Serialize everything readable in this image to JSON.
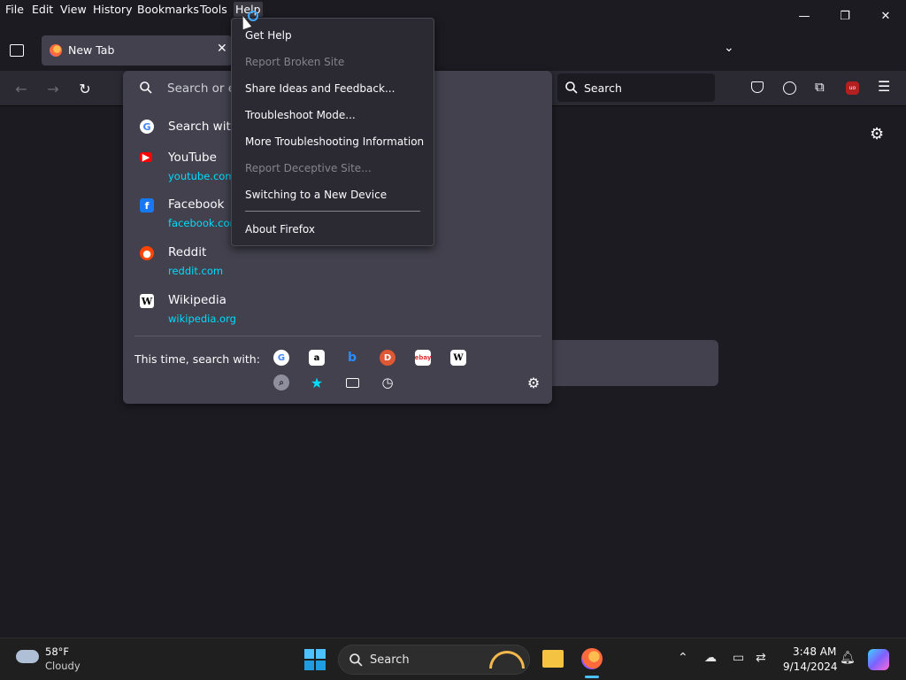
{
  "menubar": {
    "items": [
      "File",
      "Edit",
      "View",
      "History",
      "Bookmarks",
      "Tools",
      "Help"
    ]
  },
  "window_controls": {
    "minimize": "—",
    "restore": "❐",
    "close": "✕"
  },
  "tabs": [
    {
      "label": "New Tab"
    }
  ],
  "navbar": {
    "search_label": "Search"
  },
  "urlbar": {
    "placeholder": "Search or e",
    "search_with_label": "Search with",
    "results": [
      {
        "title": "YouTube",
        "url": "youtube.com"
      },
      {
        "title": "Facebook",
        "url": "facebook.com"
      },
      {
        "title": "Reddit",
        "url": "reddit.com"
      },
      {
        "title": "Wikipedia",
        "url": "wikipedia.org"
      }
    ],
    "oneoff_label": "This time, search with:"
  },
  "help_menu": {
    "items": [
      {
        "label": "Get Help",
        "enabled": true
      },
      {
        "label": "Report Broken Site",
        "enabled": false
      },
      {
        "label": "Share Ideas and Feedback...",
        "enabled": true
      },
      {
        "label": "Troubleshoot Mode...",
        "enabled": true
      },
      {
        "label": "More Troubleshooting Information",
        "enabled": true
      },
      {
        "label": "Report Deceptive Site...",
        "enabled": false
      },
      {
        "label": "Switching to a New Device",
        "enabled": true
      },
      {
        "label": "About Firefox",
        "enabled": true
      }
    ]
  },
  "taskbar": {
    "weather_temp": "58°F",
    "weather_cond": "Cloudy",
    "search_label": "Search",
    "time": "3:48 AM",
    "date": "9/14/2024"
  },
  "colors": {
    "accent_url": "#00ddff",
    "toolbar_bg": "#2b2a33",
    "panel_bg": "#42414d",
    "window_bg": "#1c1b22"
  }
}
